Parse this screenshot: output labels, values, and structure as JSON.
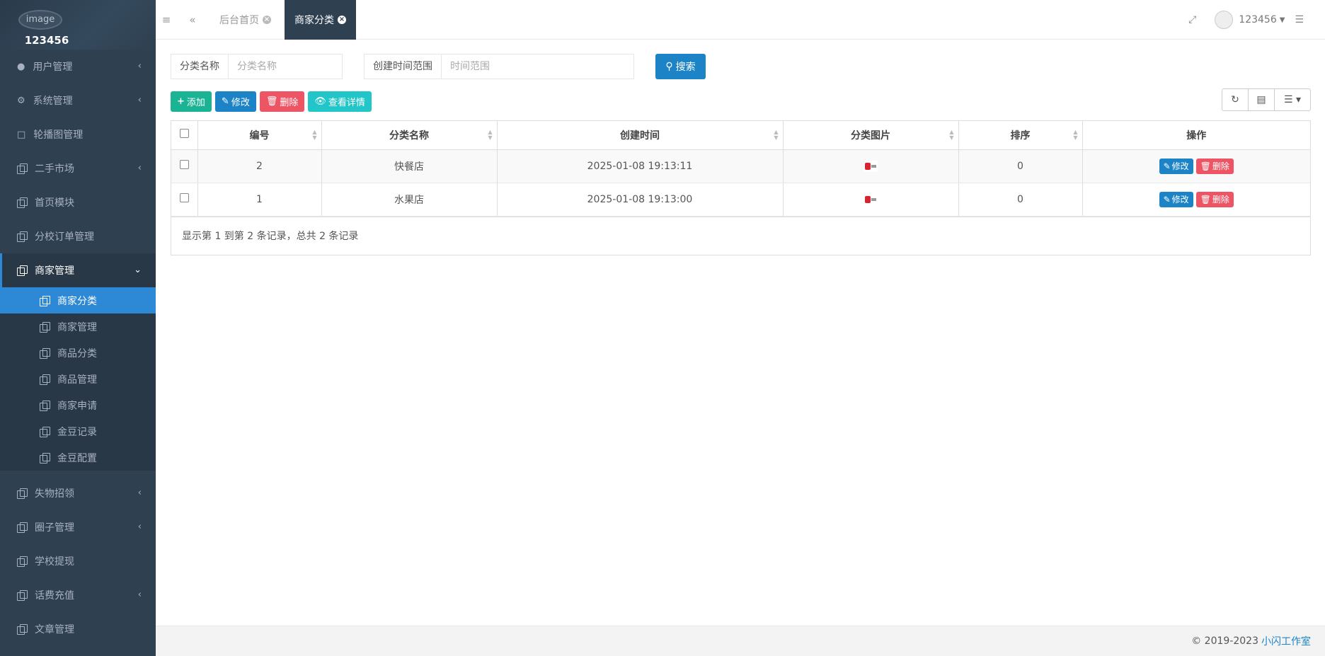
{
  "profile": {
    "avatar_alt": "image",
    "username": "123456"
  },
  "sidebar": {
    "items": [
      {
        "label": "用户管理",
        "icon": "user-icon",
        "chevron": "‹"
      },
      {
        "label": "系统管理",
        "icon": "gears-icon",
        "chevron": "‹"
      },
      {
        "label": "轮播图管理",
        "icon": "monitor-icon",
        "chevron": ""
      },
      {
        "label": "二手市场",
        "icon": "copy-icon",
        "chevron": "‹"
      },
      {
        "label": "首页模块",
        "icon": "copy-icon",
        "chevron": ""
      },
      {
        "label": "分校订单管理",
        "icon": "copy-icon",
        "chevron": ""
      },
      {
        "label": "商家管理",
        "icon": "copy-icon",
        "chevron": "⌄"
      }
    ],
    "subitems": [
      {
        "label": "商家分类"
      },
      {
        "label": "商家管理"
      },
      {
        "label": "商品分类"
      },
      {
        "label": "商品管理"
      },
      {
        "label": "商家申请"
      },
      {
        "label": "金豆记录"
      },
      {
        "label": "金豆配置"
      }
    ],
    "items_after": [
      {
        "label": "失物招领",
        "chevron": "‹"
      },
      {
        "label": "圈子管理",
        "chevron": "‹"
      },
      {
        "label": "学校提现",
        "chevron": ""
      },
      {
        "label": "话费充值",
        "chevron": "‹"
      },
      {
        "label": "文章管理",
        "chevron": ""
      }
    ]
  },
  "topbar": {
    "menu_icon": "≡",
    "back_icon": "«",
    "tabs": [
      {
        "label": "后台首页"
      },
      {
        "label": "商家分类"
      }
    ],
    "username": "123456"
  },
  "search": {
    "name_label": "分类名称",
    "name_placeholder": "分类名称",
    "time_label": "创建时间范围",
    "time_placeholder": "时间范围",
    "search_button": "搜索"
  },
  "toolbar": {
    "add": "添加",
    "edit": "修改",
    "delete": "删除",
    "view": "查看详情"
  },
  "table": {
    "columns": [
      "编号",
      "分类名称",
      "创建时间",
      "分类图片",
      "排序",
      "操作"
    ],
    "rows": [
      {
        "id": "2",
        "name": "快餐店",
        "created": "2025-01-08 19:13:11",
        "sort": "0"
      },
      {
        "id": "1",
        "name": "水果店",
        "created": "2025-01-08 19:13:00",
        "sort": "0"
      }
    ],
    "row_edit": "修改",
    "row_delete": "删除",
    "summary": "显示第 1 到第 2 条记录，总共 2 条记录"
  },
  "footer": {
    "copyright": "© 2019-2023",
    "studio": "小闪工作室"
  },
  "colors": {
    "sidebar_bg": "#2f4050",
    "primary": "#1c84c6",
    "success": "#1ab394",
    "danger": "#ed5565",
    "info": "#23c6c8",
    "selected_sub": "#2d88d5"
  }
}
